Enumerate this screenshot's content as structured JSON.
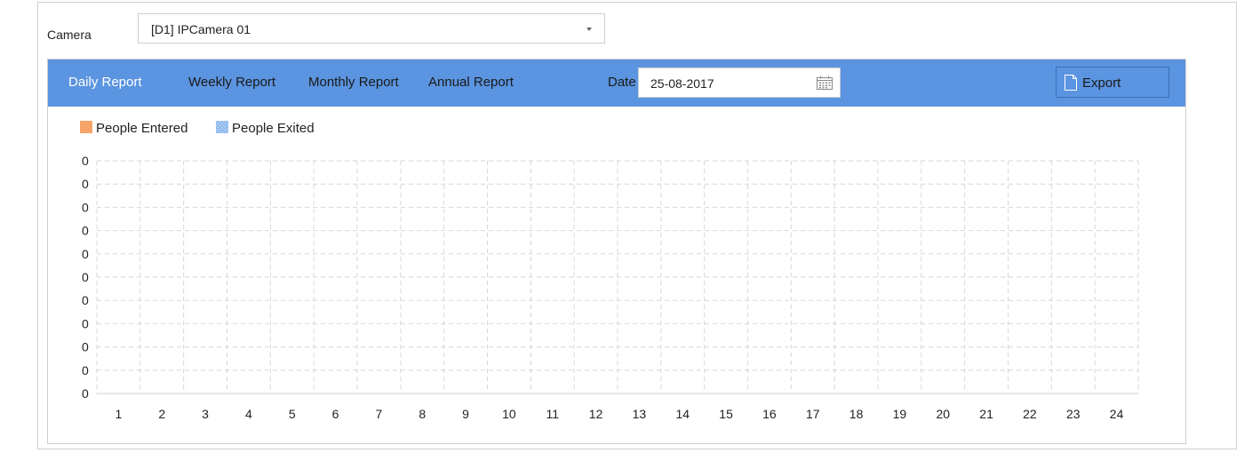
{
  "camera": {
    "label": "Camera",
    "selected": "[D1] IPCamera 01"
  },
  "toolbar": {
    "tabs": [
      {
        "label": "Daily Report",
        "active": true
      },
      {
        "label": "Weekly Report",
        "active": false
      },
      {
        "label": "Monthly Report",
        "active": false
      },
      {
        "label": "Annual Report",
        "active": false
      }
    ],
    "date_label": "Date",
    "date_value": "25-08-2017",
    "export_label": "Export"
  },
  "colors": {
    "toolbar_bg": "#5b94e0",
    "entered": "#f5a46a",
    "exited": "#8fb8ee"
  },
  "chart_data": {
    "type": "bar",
    "title": "",
    "xlabel": "",
    "ylabel": "",
    "grid": true,
    "legend_position": "top-left",
    "categories": [
      "1",
      "2",
      "3",
      "4",
      "5",
      "6",
      "7",
      "8",
      "9",
      "10",
      "11",
      "12",
      "13",
      "14",
      "15",
      "16",
      "17",
      "18",
      "19",
      "20",
      "21",
      "22",
      "23",
      "24"
    ],
    "y_ticks": [
      "0",
      "0",
      "0",
      "0",
      "0",
      "0",
      "0",
      "0",
      "0",
      "0",
      "0"
    ],
    "series": [
      {
        "name": "People Entered",
        "values": [
          0,
          0,
          0,
          0,
          0,
          0,
          0,
          0,
          0,
          0,
          0,
          0,
          0,
          0,
          0,
          0,
          0,
          0,
          0,
          0,
          0,
          0,
          0,
          0
        ]
      },
      {
        "name": "People Exited",
        "values": [
          0,
          0,
          0,
          0,
          0,
          0,
          0,
          0,
          0,
          0,
          0,
          0,
          0,
          0,
          0,
          0,
          0,
          0,
          0,
          0,
          0,
          0,
          0,
          0
        ]
      }
    ]
  }
}
